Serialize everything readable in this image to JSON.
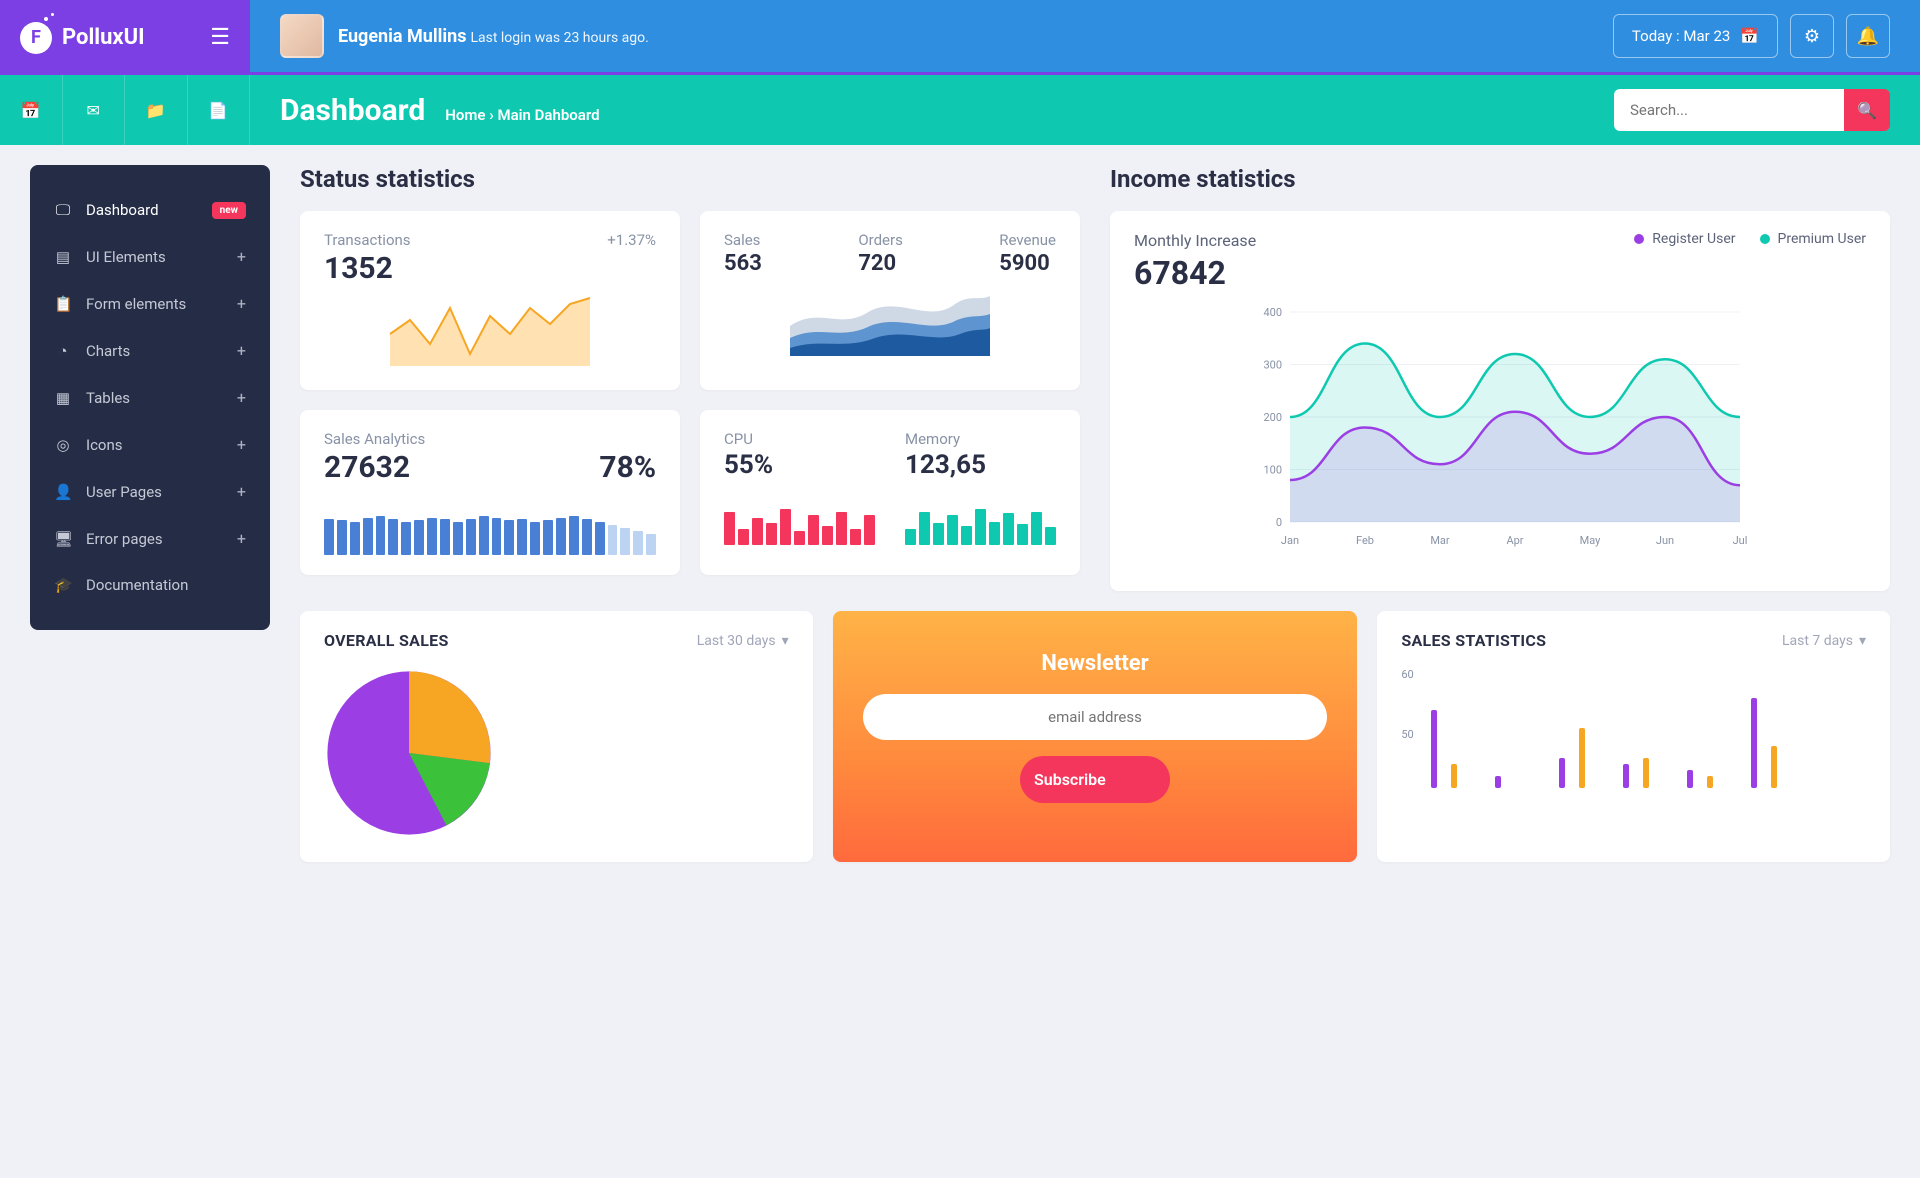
{
  "brand": {
    "name": "PolluxUI"
  },
  "header": {
    "user_name": "Eugenia Mullins",
    "last_login": "Last login was 23 hours ago.",
    "today_label": "Today : Mar 23"
  },
  "subbar": {
    "page_title": "Dashboard",
    "breadcrumb_home": "Home",
    "breadcrumb_current": "Main Dahboard",
    "search_placeholder": "Search..."
  },
  "sidebar": {
    "items": [
      {
        "label": "Dashboard",
        "badge": "new",
        "icon": "🖵"
      },
      {
        "label": "UI Elements",
        "expand": "+",
        "icon": "▤"
      },
      {
        "label": "Form elements",
        "expand": "+",
        "icon": "📋"
      },
      {
        "label": "Charts",
        "expand": "+",
        "icon": "◔"
      },
      {
        "label": "Tables",
        "expand": "+",
        "icon": "▦"
      },
      {
        "label": "Icons",
        "expand": "+",
        "icon": "◎"
      },
      {
        "label": "User Pages",
        "expand": "+",
        "icon": "👤"
      },
      {
        "label": "Error pages",
        "expand": "+",
        "icon": "🖥"
      },
      {
        "label": "Documentation",
        "icon": "🎓"
      }
    ]
  },
  "sections": {
    "status_title": "Status statistics",
    "income_title": "Income statistics"
  },
  "transactions": {
    "label": "Transactions",
    "value": "1352",
    "pct": "+1.37%"
  },
  "triple": {
    "sales_label": "Sales",
    "sales_value": "563",
    "orders_label": "Orders",
    "orders_value": "720",
    "revenue_label": "Revenue",
    "revenue_value": "5900"
  },
  "analytics": {
    "label": "Sales Analytics",
    "value": "27632",
    "pct": "78%"
  },
  "sys": {
    "cpu_label": "CPU",
    "cpu_value": "55%",
    "mem_label": "Memory",
    "mem_value": "123,65"
  },
  "income": {
    "title": "Monthly Increase",
    "value": "67842",
    "legend_a": "Register User",
    "legend_b": "Premium User",
    "colors": {
      "register": "#9b3fe4",
      "premium": "#0ec9b0"
    }
  },
  "overall": {
    "title": "OVERALL SALES",
    "range": "Last 30 days"
  },
  "newsletter": {
    "title": "Newsletter",
    "placeholder": "email address",
    "button": "Subscribe"
  },
  "salesstats": {
    "title": "SALES STATISTICS",
    "range": "Last 7 days",
    "y60": "60",
    "y50": "50"
  },
  "chart_data": [
    {
      "type": "line",
      "name": "transactions_spark",
      "x": [
        1,
        2,
        3,
        4,
        5,
        6,
        7,
        8,
        9,
        10
      ],
      "values": [
        40,
        55,
        30,
        70,
        20,
        60,
        40,
        68,
        50,
        78
      ]
    },
    {
      "type": "area",
      "name": "sales_orders_revenue_spark",
      "x": [
        1,
        2,
        3,
        4,
        5,
        6,
        7,
        8,
        9,
        10
      ],
      "series": [
        {
          "name": "Sales",
          "values": [
            30,
            45,
            35,
            50,
            42,
            60,
            55,
            70,
            58,
            65
          ]
        },
        {
          "name": "Orders",
          "values": [
            20,
            28,
            22,
            32,
            26,
            38,
            33,
            44,
            36,
            40
          ]
        },
        {
          "name": "Revenue",
          "values": [
            12,
            18,
            14,
            20,
            16,
            24,
            20,
            28,
            22,
            25
          ]
        }
      ]
    },
    {
      "type": "bar",
      "name": "sales_analytics_spark",
      "values": [
        60,
        58,
        55,
        62,
        65,
        60,
        55,
        58,
        62,
        60,
        55,
        60,
        65,
        62,
        58,
        60,
        55,
        58,
        62,
        65,
        60,
        55,
        50,
        45,
        40,
        35
      ],
      "note": "last 4 bars faded"
    },
    {
      "type": "bar",
      "name": "cpu_spark",
      "values": [
        60,
        30,
        50,
        40,
        65,
        25,
        55,
        35,
        60,
        30,
        55
      ]
    },
    {
      "type": "bar",
      "name": "memory_spark",
      "values": [
        30,
        60,
        40,
        55,
        35,
        65,
        42,
        58,
        38,
        60,
        33
      ]
    },
    {
      "type": "area",
      "name": "income_monthly",
      "title": "Monthly Increase",
      "categories": [
        "Jan",
        "Feb",
        "Mar",
        "Apr",
        "May",
        "Jun",
        "Jul"
      ],
      "series": [
        {
          "name": "Premium User",
          "color": "#0ec9b0",
          "values": [
            200,
            340,
            200,
            320,
            200,
            310,
            200
          ]
        },
        {
          "name": "Register User",
          "color": "#9b3fe4",
          "values": [
            80,
            180,
            110,
            210,
            130,
            200,
            70
          ]
        }
      ],
      "ylim": [
        0,
        400
      ],
      "yticks": [
        0,
        100,
        200,
        300,
        400
      ]
    },
    {
      "type": "pie",
      "name": "overall_sales",
      "series": [
        {
          "name": "Purple",
          "color": "#9b3fe4",
          "value": 55
        },
        {
          "name": "Orange",
          "color": "#f6a623",
          "value": 25
        },
        {
          "name": "Green",
          "color": "#3cc13b",
          "value": 20
        }
      ]
    },
    {
      "type": "bar",
      "name": "sales_statistics",
      "series": [
        {
          "name": "A",
          "color": "#9b3fe4",
          "values": [
            53,
            42,
            45,
            44,
            43,
            55
          ]
        },
        {
          "name": "B",
          "color": "#f6a623",
          "values": [
            44,
            36,
            50,
            45,
            42,
            47
          ]
        }
      ],
      "ylim": [
        40,
        60
      ]
    }
  ]
}
